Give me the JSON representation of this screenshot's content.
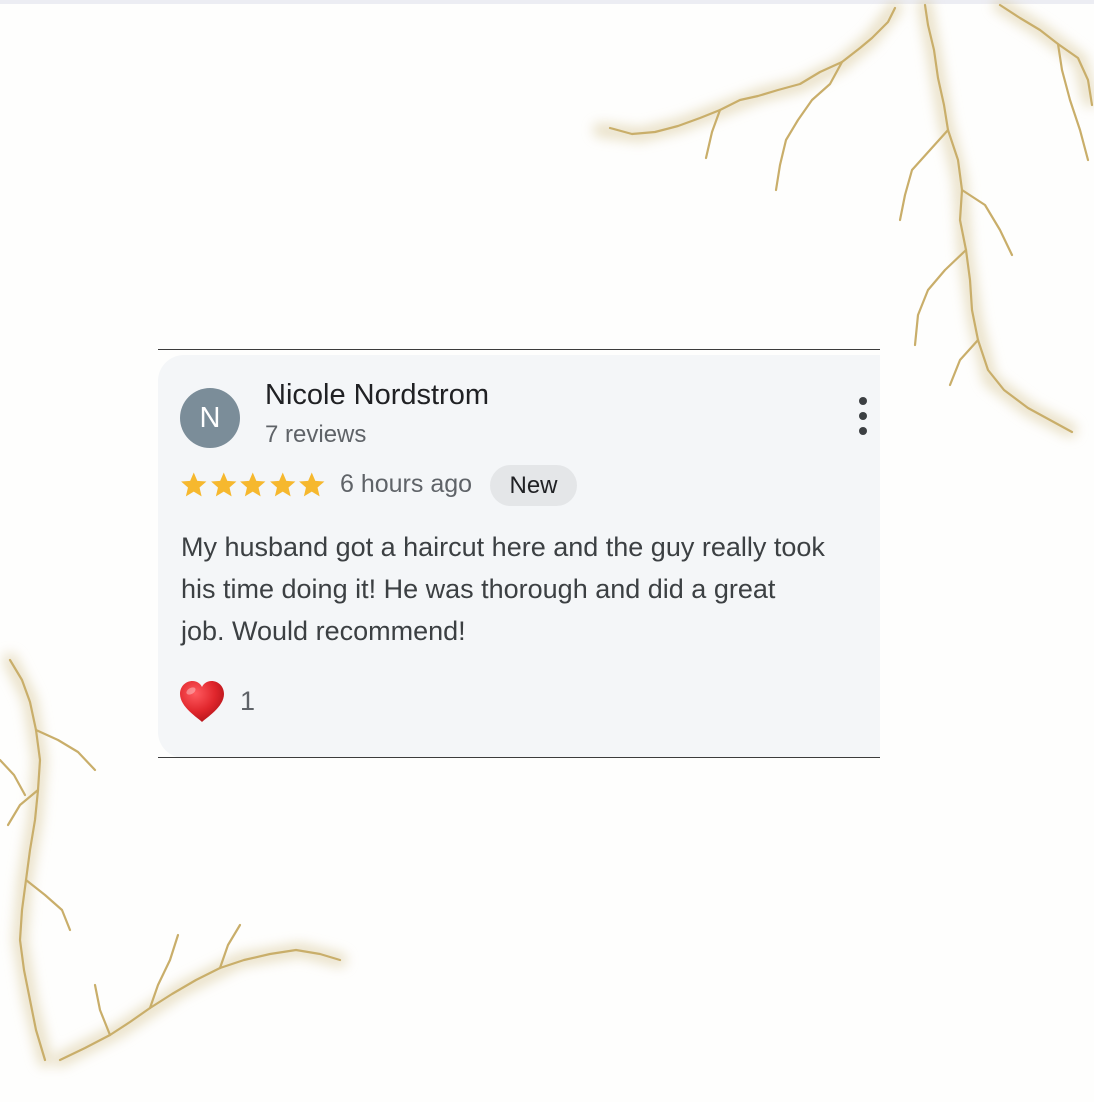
{
  "review": {
    "avatar_initial": "N",
    "reviewer_name": "Nicole Nordstrom",
    "review_count": "7 reviews",
    "rating": 5,
    "rating_max": 5,
    "time_ago": "6 hours ago",
    "badge": "New",
    "text_lines": [
      "My husband got a haircut here and the guy really took",
      "his time doing it! He was thorough and did a great",
      "job. Would recommend!"
    ],
    "reaction_icon": "heart-icon",
    "reaction_count": "1"
  },
  "colors": {
    "avatar_bg": "#7b8d99",
    "star": "#f6b82e",
    "heart": "#d91f26",
    "card_bg": "#f4f6f8",
    "badge_bg": "#e4e6e8",
    "decor_gold": "#c9ae6a"
  }
}
